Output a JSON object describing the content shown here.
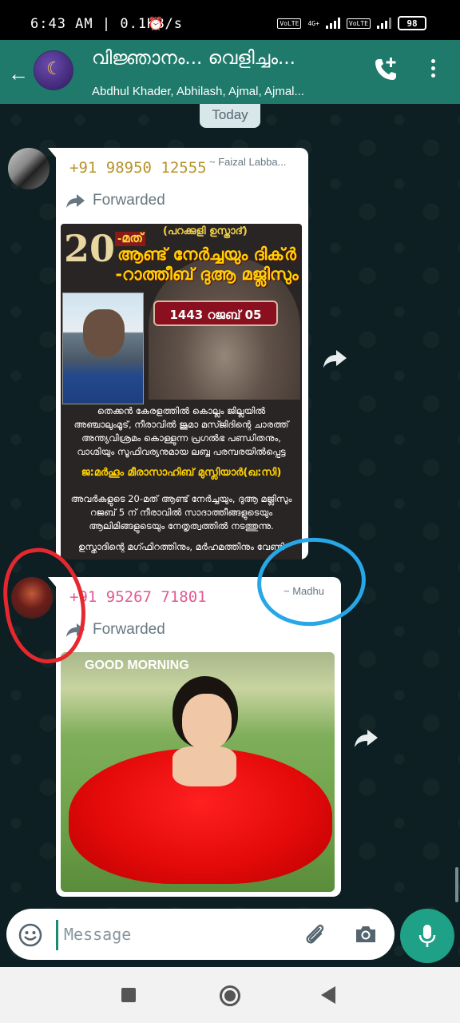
{
  "status_bar": {
    "time": "6:43 AM | 0.1KB/s",
    "alarm_icon": "alarm-icon",
    "sim1": "VoLTE",
    "sim2": "VoLTE",
    "network": "4G+",
    "battery": "98"
  },
  "header": {
    "title": "വിജ്ഞാനം... വെളിച്ചം...",
    "subtitle": "Abdhul Khader, Abhilash, Ajmal, Ajmal...",
    "icons": [
      "back-arrow-icon",
      "add-call-icon",
      "more-vert-icon"
    ]
  },
  "chat": {
    "date_chip": "Today",
    "messages": [
      {
        "phone": "+91 98950 12555",
        "name": "~ Faizal Labba...",
        "forwarded": "Forwarded",
        "poster": {
          "small_title": "(പറക്കുളി ഉസ്താദ്)",
          "number": "20",
          "suffix": "-മത്",
          "title": "ആണ്ട് നേർച്ചയും ദിക്ർ -റാത്തീബ് ദുആ മജ്ലിസും",
          "date": "1443 റജബ് 05",
          "text1": "തെക്കൻ കേരളത്തിൽ കൊല്ലം ജില്ലയിൽ അഞ്ചാലുംമൂട്, നീരാവിൽ ജുമാ മസ്ജിദിന്റെ ചാരത്ത് അന്ത്യവിശ്രമം കൊള്ളുന്ന പ്രഗൽഭ പണ്ഡിതനും, വാഗ്മിയും സൂഫിവര്യനുമായ ലബ്ബ പരമ്പരയിൽപ്പെട്ട",
          "name_line": "ജ:മർഹൂം മീരാസാഹിബ് മുസ്ലിയാർ(ഖ:സി)",
          "text2": "അവർകളുടെ 20-മത് ആണ്ട് നേർച്ചയും, ദുആ മജ്ലിസും റജബ് 5 ന് നീരാവിൽ സാദാത്തീങ്ങളുടെയും ആലിമിങ്ങളുടെയും നേതൃത്വത്തിൽ നടത്തുന്നു.",
          "text3": "ഉസ്താദിന്റെ മഗ്ഫിറത്തിനും, മർഹമത്തിനും വേണ്ടി"
        }
      },
      {
        "phone": "+91 95267 71801",
        "name": "~ Madhu",
        "forwarded": "Forwarded",
        "image_caption": "GOOD MORNING"
      }
    ]
  },
  "input": {
    "placeholder": "Message",
    "icons": [
      "emoji-icon",
      "attach-icon",
      "camera-icon",
      "mic-icon"
    ]
  },
  "colors": {
    "header_bg": "#1f7a6b",
    "accent": "#1ea186",
    "annotation_red": "#e6282e",
    "annotation_blue": "#27a7e8"
  }
}
